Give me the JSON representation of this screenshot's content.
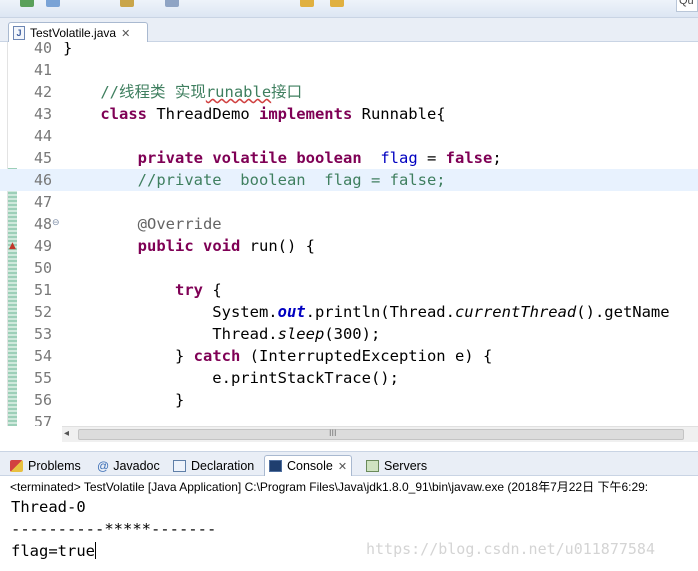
{
  "toolbar": {
    "quick_access": "Qu",
    "icons": [
      "run-icon",
      "debug-icon",
      "search-icon",
      "save-icon",
      "nav-back-icon",
      "nav-forward-icon"
    ]
  },
  "editor": {
    "tab": {
      "file_name": "TestVolatile.java",
      "file_icon": "J",
      "close": "✕"
    },
    "lines": [
      {
        "num": "40",
        "parts": [
          {
            "t": "}",
            "c": ""
          }
        ]
      },
      {
        "num": "41",
        "parts": []
      },
      {
        "num": "42",
        "parts": [
          {
            "t": "    //线程类 实现",
            "c": "cm"
          },
          {
            "t": "runable",
            "c": "cm spell"
          },
          {
            "t": "接口",
            "c": "cm"
          }
        ]
      },
      {
        "num": "43",
        "parts": [
          {
            "t": "    ",
            "c": ""
          },
          {
            "t": "class",
            "c": "kw"
          },
          {
            "t": " ThreadDemo ",
            "c": ""
          },
          {
            "t": "implements",
            "c": "kw"
          },
          {
            "t": " Runnable{",
            "c": ""
          }
        ]
      },
      {
        "num": "44",
        "parts": []
      },
      {
        "num": "45",
        "parts": [
          {
            "t": "        ",
            "c": ""
          },
          {
            "t": "private",
            "c": "kw"
          },
          {
            "t": " ",
            "c": ""
          },
          {
            "t": "volatile",
            "c": "kw"
          },
          {
            "t": " ",
            "c": ""
          },
          {
            "t": "boolean",
            "c": "kw"
          },
          {
            "t": "  ",
            "c": ""
          },
          {
            "t": "flag",
            "c": "fld"
          },
          {
            "t": " = ",
            "c": ""
          },
          {
            "t": "false",
            "c": "kw"
          },
          {
            "t": ";",
            "c": ""
          }
        ]
      },
      {
        "num": "46",
        "current": true,
        "parts": [
          {
            "t": "        //private  boolean  flag = false;",
            "c": "cm"
          }
        ]
      },
      {
        "num": "47",
        "parts": []
      },
      {
        "num": "48",
        "fold": true,
        "parts": [
          {
            "t": "        @Override",
            "c": "ann"
          }
        ]
      },
      {
        "num": "49",
        "override": true,
        "parts": [
          {
            "t": "        ",
            "c": ""
          },
          {
            "t": "public",
            "c": "kw"
          },
          {
            "t": " ",
            "c": ""
          },
          {
            "t": "void",
            "c": "kw"
          },
          {
            "t": " run() {",
            "c": ""
          }
        ]
      },
      {
        "num": "50",
        "parts": []
      },
      {
        "num": "51",
        "parts": [
          {
            "t": "            ",
            "c": ""
          },
          {
            "t": "try",
            "c": "kw"
          },
          {
            "t": " {",
            "c": ""
          }
        ]
      },
      {
        "num": "52",
        "parts": [
          {
            "t": "                System.",
            "c": ""
          },
          {
            "t": "out",
            "c": "fldb"
          },
          {
            "t": ".println(Thread.",
            "c": ""
          },
          {
            "t": "currentThread",
            "c": "it"
          },
          {
            "t": "().getName",
            "c": ""
          }
        ]
      },
      {
        "num": "53",
        "parts": [
          {
            "t": "                Thread.",
            "c": ""
          },
          {
            "t": "sleep",
            "c": "it"
          },
          {
            "t": "(300);",
            "c": ""
          }
        ]
      },
      {
        "num": "54",
        "parts": [
          {
            "t": "            } ",
            "c": ""
          },
          {
            "t": "catch",
            "c": "kw"
          },
          {
            "t": " (InterruptedException e) {",
            "c": ""
          }
        ]
      },
      {
        "num": "55",
        "parts": [
          {
            "t": "                e.printStackTrace();",
            "c": ""
          }
        ]
      },
      {
        "num": "56",
        "parts": [
          {
            "t": "            }",
            "c": ""
          }
        ]
      },
      {
        "num": "57",
        "parts": []
      }
    ],
    "scrollbar_grip": "III"
  },
  "panel": {
    "tabs": [
      {
        "id": "problems",
        "label": "Problems",
        "icon": "problems-icon"
      },
      {
        "id": "javadoc",
        "label": "Javadoc",
        "icon": "javadoc-icon",
        "glyph": "@"
      },
      {
        "id": "declaration",
        "label": "Declaration",
        "icon": "declaration-icon"
      },
      {
        "id": "console",
        "label": "Console",
        "icon": "console-icon",
        "active": true,
        "close": "✕"
      },
      {
        "id": "servers",
        "label": "Servers",
        "icon": "servers-icon"
      }
    ]
  },
  "console": {
    "terminated": "<terminated> TestVolatile [Java Application] C:\\Program Files\\Java\\jdk1.8.0_91\\bin\\javaw.exe (2018年7月22日 下午6:29:",
    "output": [
      "Thread-0",
      "----------*****-------",
      "flag=true"
    ],
    "watermark": "https://blog.csdn.net/u011877584"
  },
  "colors": {
    "keyword": "#7f0055",
    "comment": "#3f7f5f",
    "field": "#0000c0",
    "current_line": "#e8f2fe"
  }
}
